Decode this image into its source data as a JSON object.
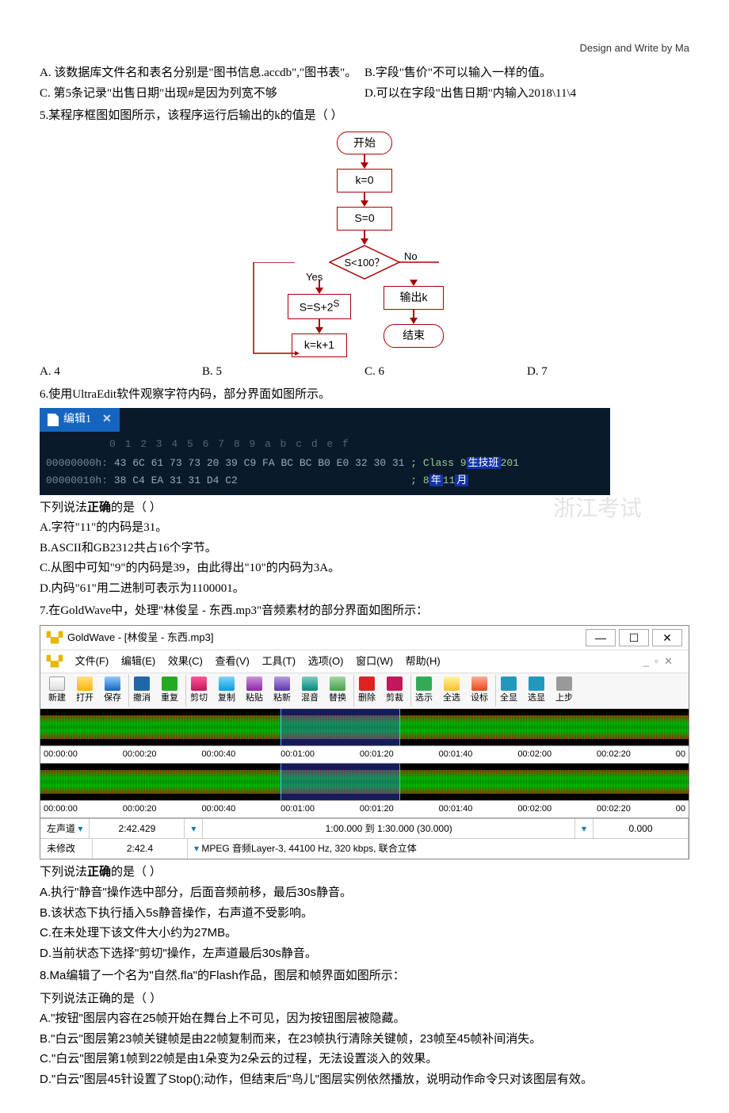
{
  "header": "Design and Write by Ma",
  "opts_abcd": {
    "a": "A. 该数据库文件名和表名分别是\"图书信息.accdb\",\"图书表\"。",
    "b": "B.字段\"售价\"不可以输入一样的值。",
    "c": "C. 第5条记录\"出售日期\"出现#是因为列宽不够",
    "d": "D.可以在字段\"出售日期\"内输入2018\\11\\4"
  },
  "q5": {
    "stem": "5.某程序框图如图所示，该程序运行后输出的k的值是（    ）",
    "a": "A. 4",
    "b": "B. 5",
    "c": "C. 6",
    "d": "D. 7"
  },
  "flow": {
    "start": "开始",
    "k0": "k=0",
    "s0": "S=0",
    "cond": "S<100？",
    "yes": "Yes",
    "no": "No",
    "assign": "S=S+2",
    "sup": "S",
    "kpp": "k=k+1",
    "out": "输出k",
    "end": "结束"
  },
  "q6": {
    "stem": "6.使用UltraEdit软件观察字符内码，部分界面如图所示。",
    "tab": "编辑1",
    "ruler": "0  1  2  3  4  5  6  7  8  9  a  b  c  d  e  f",
    "l1a": "00000000h:",
    "l1h": " 43 6C 61 73 73 20 39 C9 FA BC BC B0 E0 32 30 31 ",
    "l1t": "; Class 9",
    "l1c": "生技班",
    "l1s": "201",
    "l2a": "00000010h:",
    "l2h": " 38 C4 EA 31 31 D4 C2                            ",
    "l2t": "; 8",
    "l2c": "年",
    "l2m": "11",
    "l2c2": "月",
    "lead": "下列说法",
    "correct": "正确",
    "tail": "的是（    ）",
    "oa": "A.字符\"11\"的内码是31。",
    "ob": "B.ASCII和GB2312共占16个字节。",
    "oc": "C.从图中可知\"9\"的内码是39，由此得出\"10\"的内码为3A。",
    "od": "D.内码\"61\"用二进制可表示为1100001。",
    "wm": "浙江考试"
  },
  "q7": {
    "stem": "7.在GoldWave中，处理\"林俊呈 - 东西.mp3\"音频素材的部分界面如图所示：",
    "title": "GoldWave - [林俊呈 - 东西.mp3]",
    "menu": {
      "logo": "✕✕",
      "file": "文件(F)",
      "edit": "编辑(E)",
      "fx": "效果(C)",
      "view": "查看(V)",
      "tool": "工具(T)",
      "opt": "选项(O)",
      "win": "窗口(W)",
      "help": "帮助(H)"
    },
    "tb": [
      "新建",
      "打开",
      "保存",
      "撤消",
      "重复",
      "剪切",
      "复制",
      "粘贴",
      "粘新",
      "混音",
      "替换",
      "删除",
      "剪裁",
      "选示",
      "全选",
      "设标",
      "全显",
      "选显",
      "上步"
    ],
    "tl": [
      "00:00:00",
      "00:00:20",
      "00:00:40",
      "00:01:00",
      "00:01:20",
      "00:01:40",
      "00:02:00",
      "00:02:20",
      "00"
    ],
    "stat": {
      "ch": "左声道",
      "dur": "2:42.429",
      "sel": "1:00.000 到 1:30.000 (30.000)",
      "zoom": "0.000",
      "mod": "未修改",
      "dur2": "2:42.4",
      "fmt": "MPEG 音频Layer-3, 44100 Hz, 320 kbps, 联合立体"
    },
    "lead": "下列说法",
    "correct": "正确",
    "tail": "的是（    ）",
    "oa": "A.执行\"静音\"操作选中部分，后面音频前移，最后30s静音。",
    "ob": "B.该状态下执行插入5s静音操作，右声道不受影响。",
    "oc": "C.在未处理下该文件大小约为27MB。",
    "od": "D.当前状态下选择\"剪切\"操作，左声道最后30s静音。"
  },
  "q8": {
    "stem": "8.Ma编辑了一个名为\"自然.fla\"的Flash作品，图层和帧界面如图所示：",
    "lead": "下列说法正确的是（    ）",
    "oa": "A.\"按钮\"图层内容在25帧开始在舞台上不可见，因为按钮图层被隐藏。",
    "ob": "B.\"白云\"图层第23帧关键帧是由22帧复制而来，在23帧执行清除关键帧，23帧至45帧补间消失。",
    "oc": "C.\"白云\"图层第1帧到22帧是由1朵变为2朵云的过程，无法设置淡入的效果。",
    "od": "D.\"白云\"图层45针设置了Stop();动作，但结束后\"鸟儿\"图层实例依然播放，说明动作命令只对该图层有效。"
  }
}
